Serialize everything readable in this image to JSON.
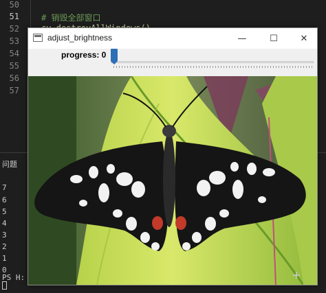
{
  "editor": {
    "line_numbers": [
      "50",
      "51",
      "52",
      "53",
      "54",
      "55",
      "56",
      "57"
    ],
    "comment": "# 销毁全部窗口",
    "code_partial": "cv.destroyAllWindows()"
  },
  "panel": {
    "title": "问题",
    "lines": [
      "7",
      "6",
      "5",
      "4",
      "3",
      "2",
      "1",
      "0"
    ],
    "prompt": "PS H:"
  },
  "window": {
    "title": "adjust_brightness",
    "controls": {
      "minimize_glyph": "—",
      "maximize_glyph": "☐",
      "close_glyph": "✕"
    }
  },
  "trackbar": {
    "label": "progress: 0",
    "value": 0,
    "min": 0,
    "accent_color": "#2f6fb5"
  },
  "image": {
    "subject_icon": "butterfly-image"
  },
  "colors": {
    "editor_bg": "#1e1e1e",
    "comment": "#6a9955",
    "line_number": "#858585"
  }
}
